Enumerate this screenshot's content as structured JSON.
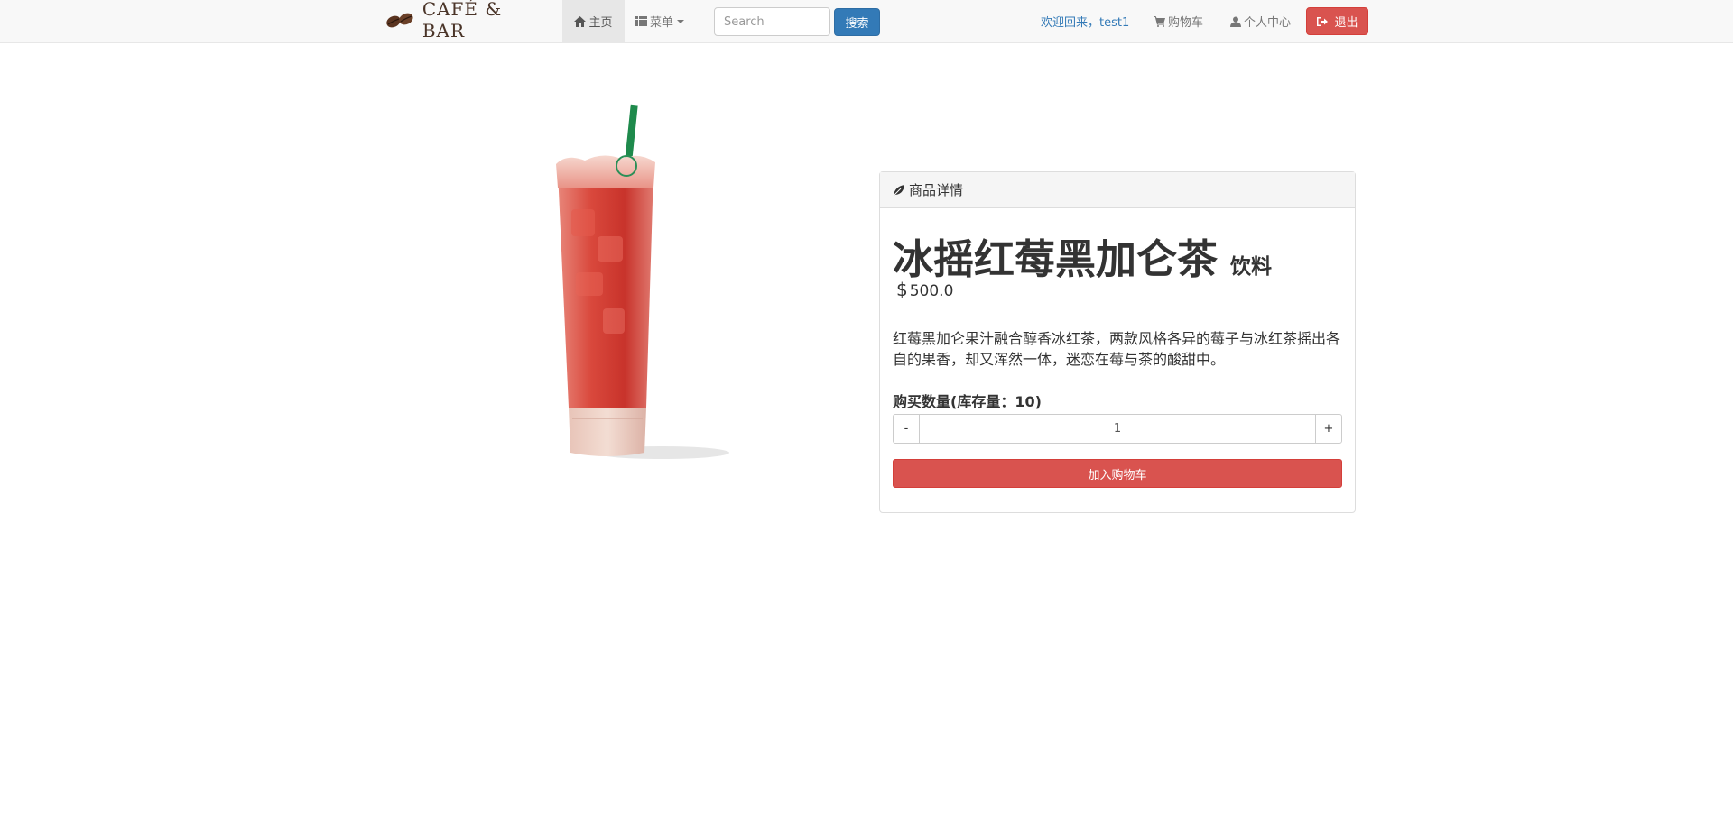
{
  "navbar": {
    "brand": "CAFÉ & BAR",
    "home_label": "主页",
    "menu_label": "菜单",
    "search": {
      "placeholder": "Search",
      "button_label": "搜索"
    },
    "welcome": "欢迎回来，test1",
    "cart_label": "购物车",
    "profile_label": "个人中心",
    "logout_label": "退出"
  },
  "panel": {
    "heading": "商品详情",
    "product": {
      "name": "冰摇红莓黑加仑茶",
      "category": "饮料",
      "currency": "$",
      "price": "500.0",
      "description": "红莓黑加仑果汁融合醇香冰红茶，两款风格各异的莓子与冰红茶摇出各自的果香，却又浑然一体，迷恋在莓与茶的酸甜中。"
    },
    "quantity": {
      "label": "购买数量(库存量：10)",
      "minus": "-",
      "plus": "+",
      "value": "1"
    },
    "add_to_cart_label": "加入购物车"
  },
  "colors": {
    "primary": "#337ab7",
    "danger": "#d9534f",
    "drink_red": "#c9302c",
    "straw_green": "#1e8a4c"
  }
}
